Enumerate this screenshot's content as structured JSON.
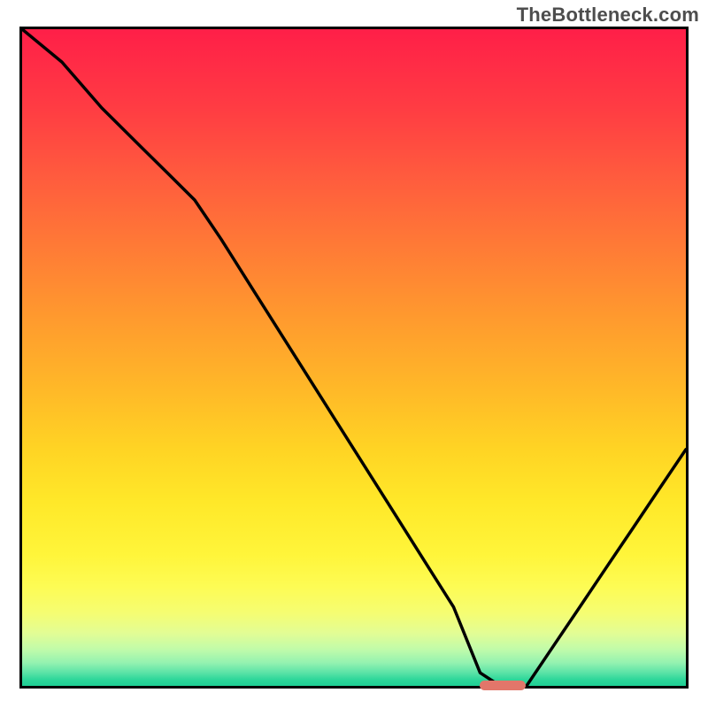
{
  "watermark": "TheBottleneck.com",
  "chart_data": {
    "type": "line",
    "title": "",
    "xlabel": "",
    "ylabel": "",
    "xlim": [
      0,
      100
    ],
    "ylim": [
      0,
      100
    ],
    "grid": false,
    "legend": false,
    "marker": {
      "x_start": 69,
      "x_end": 76,
      "y": 0,
      "color": "#e2766a"
    },
    "series": [
      {
        "name": "bottleneck-curve",
        "color": "#000000",
        "x": [
          0,
          6,
          12,
          18,
          22,
          26,
          30,
          35,
          40,
          45,
          50,
          55,
          60,
          65,
          69,
          72,
          76,
          80,
          84,
          88,
          92,
          96,
          100
        ],
        "y": [
          100,
          95,
          88,
          82,
          78,
          74,
          68,
          60,
          52,
          44,
          36,
          28,
          20,
          12,
          2,
          0,
          0,
          6,
          12,
          18,
          24,
          30,
          36
        ]
      }
    ],
    "gradient_stops": [
      {
        "pos": 0,
        "color": "#ff1f48"
      },
      {
        "pos": 0.5,
        "color": "#ffb928"
      },
      {
        "pos": 0.85,
        "color": "#fdfc55"
      },
      {
        "pos": 1.0,
        "color": "#1fd095"
      }
    ]
  }
}
